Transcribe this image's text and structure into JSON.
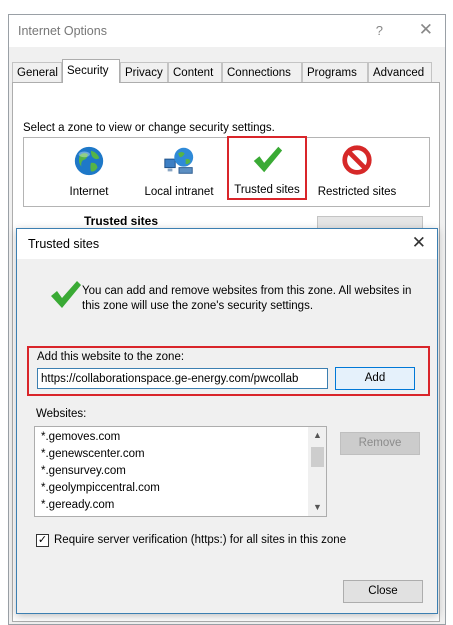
{
  "internet_options": {
    "title": "Internet Options",
    "help_glyph": "?",
    "close_glyph": "✕",
    "tabs": [
      "General",
      "Security",
      "Privacy",
      "Content",
      "Connections",
      "Programs",
      "Advanced"
    ],
    "active_tab": "Security",
    "zone_hint": "Select a zone to view or change security settings.",
    "zones": [
      {
        "label": "Internet",
        "icon": "globe-icon"
      },
      {
        "label": "Local intranet",
        "icon": "intranet-icon"
      },
      {
        "label": "Trusted sites",
        "icon": "checkmark-icon",
        "selected": true
      },
      {
        "label": "Restricted sites",
        "icon": "restricted-icon"
      }
    ],
    "zone_heading": "Trusted sites"
  },
  "trusted_sites_dialog": {
    "title": "Trusted sites",
    "close_glyph": "✕",
    "description": "You can add and remove websites from this zone. All websites in this zone will use the zone's security settings.",
    "add_label": "Add this website to the zone:",
    "add_input_value": "https://collaborationspace.ge-energy.com/pwcollab",
    "add_button": "Add",
    "websites_label": "Websites:",
    "websites": [
      "*.gemoves.com",
      "*.genewscenter.com",
      "*.gensurvey.com",
      "*.geolympiccentral.com",
      "*.geready.com"
    ],
    "remove_button": "Remove",
    "verify_checked": true,
    "verify_label": "Require server verification (https:) for all sites in this zone",
    "close_button": "Close"
  },
  "colors": {
    "highlight_red": "#d9252a",
    "check_green": "#3aaa35",
    "accent_blue": "#0078d7"
  }
}
